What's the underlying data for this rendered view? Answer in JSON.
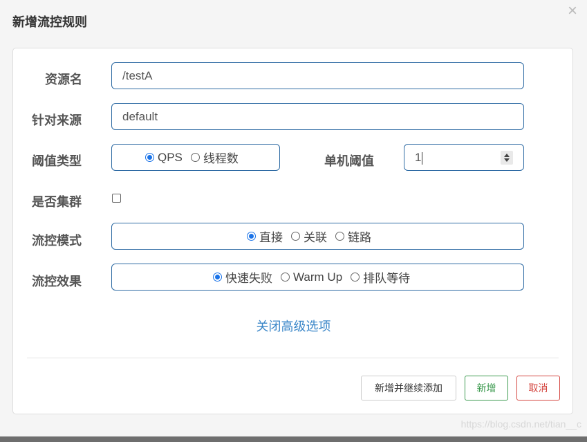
{
  "modal": {
    "title": "新增流控规则",
    "close_glyph": "×"
  },
  "form": {
    "resource": {
      "label": "资源名",
      "value": "/testA"
    },
    "limit_app": {
      "label": "针对来源",
      "value": "default"
    },
    "threshold_type": {
      "label": "阈值类型",
      "options": [
        "QPS",
        "线程数"
      ],
      "selected": "QPS"
    },
    "single_threshold": {
      "label": "单机阈值",
      "value": "1"
    },
    "cluster": {
      "label": "是否集群",
      "checked": false
    },
    "flow_mode": {
      "label": "流控模式",
      "options": [
        "直接",
        "关联",
        "链路"
      ],
      "selected": "直接"
    },
    "flow_effect": {
      "label": "流控效果",
      "options": [
        "快速失败",
        "Warm Up",
        "排队等待"
      ],
      "selected": "快速失败"
    },
    "advanced_toggle": "关闭高级选项"
  },
  "buttons": {
    "add_continue": "新增并继续添加",
    "add": "新增",
    "cancel": "取消"
  },
  "colors": {
    "accent": "#1a73e8",
    "field_border": "#2d6aa3",
    "link": "#3a86c8",
    "success": "#3c9a4f",
    "danger": "#d4453f"
  },
  "watermark": "https://blog.csdn.net/tian__c"
}
